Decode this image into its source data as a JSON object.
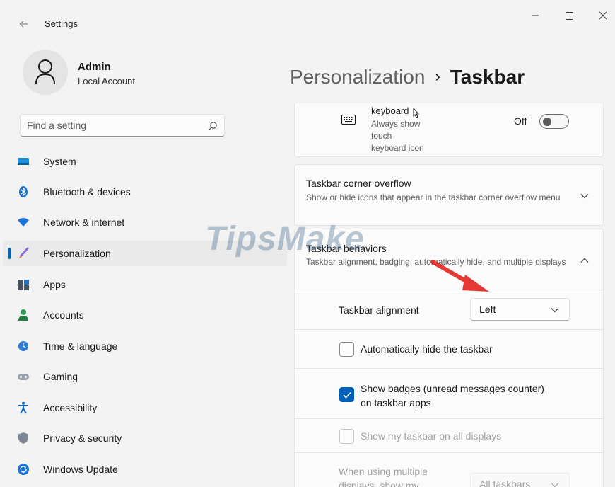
{
  "window": {
    "title": "Settings",
    "controls": [
      "minimize",
      "maximize",
      "close"
    ]
  },
  "user": {
    "name": "Admin",
    "account_type": "Local Account"
  },
  "search": {
    "placeholder": "Find a setting"
  },
  "sidebar": {
    "items": [
      {
        "label": "System",
        "icon": "system-icon",
        "active": false
      },
      {
        "label": "Bluetooth & devices",
        "icon": "bluetooth-icon",
        "active": false
      },
      {
        "label": "Network & internet",
        "icon": "network-icon",
        "active": false
      },
      {
        "label": "Personalization",
        "icon": "personalization-icon",
        "active": true
      },
      {
        "label": "Apps",
        "icon": "apps-icon",
        "active": false
      },
      {
        "label": "Accounts",
        "icon": "accounts-icon",
        "active": false
      },
      {
        "label": "Time & language",
        "icon": "time-language-icon",
        "active": false
      },
      {
        "label": "Gaming",
        "icon": "gaming-icon",
        "active": false
      },
      {
        "label": "Accessibility",
        "icon": "accessibility-icon",
        "active": false
      },
      {
        "label": "Privacy & security",
        "icon": "privacy-security-icon",
        "active": false
      },
      {
        "label": "Windows Update",
        "icon": "windows-update-icon",
        "active": false
      }
    ]
  },
  "breadcrumb": {
    "parent": "Personalization",
    "separator": "›",
    "current": "Taskbar"
  },
  "content": {
    "touch_keyboard": {
      "title": "keyboard",
      "description": [
        "Always show",
        "touch",
        "keyboard icon"
      ],
      "state_label": "Off",
      "enabled": false
    },
    "corner_overflow": {
      "title": "Taskbar corner overflow",
      "description": "Show or hide icons that appear in the taskbar corner overflow menu",
      "expanded": false
    },
    "behaviors": {
      "title": "Taskbar behaviors",
      "description": "Taskbar alignment, badging, automatically hide, and multiple displays",
      "expanded": true,
      "alignment": {
        "label": "Taskbar alignment",
        "value": "Left"
      },
      "auto_hide": {
        "label": "Automatically hide the taskbar",
        "checked": false
      },
      "badges": {
        "label_line1": "Show badges (unread messages counter)",
        "label_line2": "on taskbar apps",
        "checked": true
      },
      "all_displays": {
        "label": "Show my taskbar on all displays",
        "checked": false,
        "disabled": true
      },
      "multiple_displays": {
        "label_line1": "When using multiple",
        "label_line2": "displays, show my",
        "value": "All taskbars",
        "disabled": true
      }
    }
  },
  "watermark": {
    "text": "TipsMake"
  },
  "colors": {
    "accent": "#005fb8",
    "nav_indicator": "#0067c0",
    "annotation_arrow": "#e53935",
    "background": "#f3f3f3"
  }
}
